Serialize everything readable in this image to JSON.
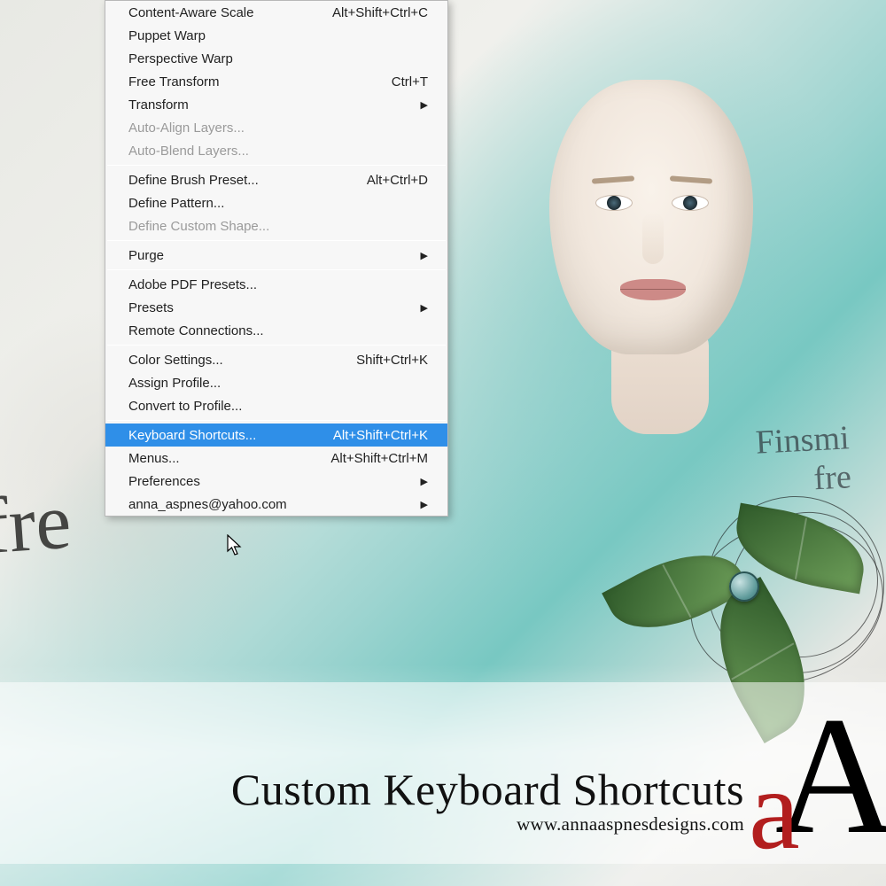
{
  "menu": {
    "groups": [
      [
        {
          "label": "Content-Aware Scale",
          "shortcut": "Alt+Shift+Ctrl+C",
          "submenu": false,
          "disabled": false
        },
        {
          "label": "Puppet Warp",
          "shortcut": "",
          "submenu": false,
          "disabled": false
        },
        {
          "label": "Perspective Warp",
          "shortcut": "",
          "submenu": false,
          "disabled": false
        },
        {
          "label": "Free Transform",
          "shortcut": "Ctrl+T",
          "submenu": false,
          "disabled": false
        },
        {
          "label": "Transform",
          "shortcut": "",
          "submenu": true,
          "disabled": false
        },
        {
          "label": "Auto-Align Layers...",
          "shortcut": "",
          "submenu": false,
          "disabled": true
        },
        {
          "label": "Auto-Blend Layers...",
          "shortcut": "",
          "submenu": false,
          "disabled": true
        }
      ],
      [
        {
          "label": "Define Brush Preset...",
          "shortcut": "Alt+Ctrl+D",
          "submenu": false,
          "disabled": false
        },
        {
          "label": "Define Pattern...",
          "shortcut": "",
          "submenu": false,
          "disabled": false
        },
        {
          "label": "Define Custom Shape...",
          "shortcut": "",
          "submenu": false,
          "disabled": true
        }
      ],
      [
        {
          "label": "Purge",
          "shortcut": "",
          "submenu": true,
          "disabled": false
        }
      ],
      [
        {
          "label": "Adobe PDF Presets...",
          "shortcut": "",
          "submenu": false,
          "disabled": false
        },
        {
          "label": "Presets",
          "shortcut": "",
          "submenu": true,
          "disabled": false
        },
        {
          "label": "Remote Connections...",
          "shortcut": "",
          "submenu": false,
          "disabled": false
        }
      ],
      [
        {
          "label": "Color Settings...",
          "shortcut": "Shift+Ctrl+K",
          "submenu": false,
          "disabled": false
        },
        {
          "label": "Assign Profile...",
          "shortcut": "",
          "submenu": false,
          "disabled": false
        },
        {
          "label": "Convert to Profile...",
          "shortcut": "",
          "submenu": false,
          "disabled": false
        }
      ],
      [
        {
          "label": "Keyboard Shortcuts...",
          "shortcut": "Alt+Shift+Ctrl+K",
          "submenu": false,
          "disabled": false,
          "selected": true
        },
        {
          "label": "Menus...",
          "shortcut": "Alt+Shift+Ctrl+M",
          "submenu": false,
          "disabled": false
        },
        {
          "label": "Preferences",
          "shortcut": "",
          "submenu": true,
          "disabled": false
        },
        {
          "label": "anna_aspnes@yahoo.com",
          "shortcut": "",
          "submenu": true,
          "disabled": false
        }
      ]
    ]
  },
  "title": {
    "main": "Custom Keyboard Shortcuts",
    "url": "www.annaaspnesdesigns.com"
  },
  "logo": {
    "small": "a",
    "large": "A"
  },
  "decor": {
    "script_left": "fre",
    "script_right": "Finsmi\nfre"
  }
}
